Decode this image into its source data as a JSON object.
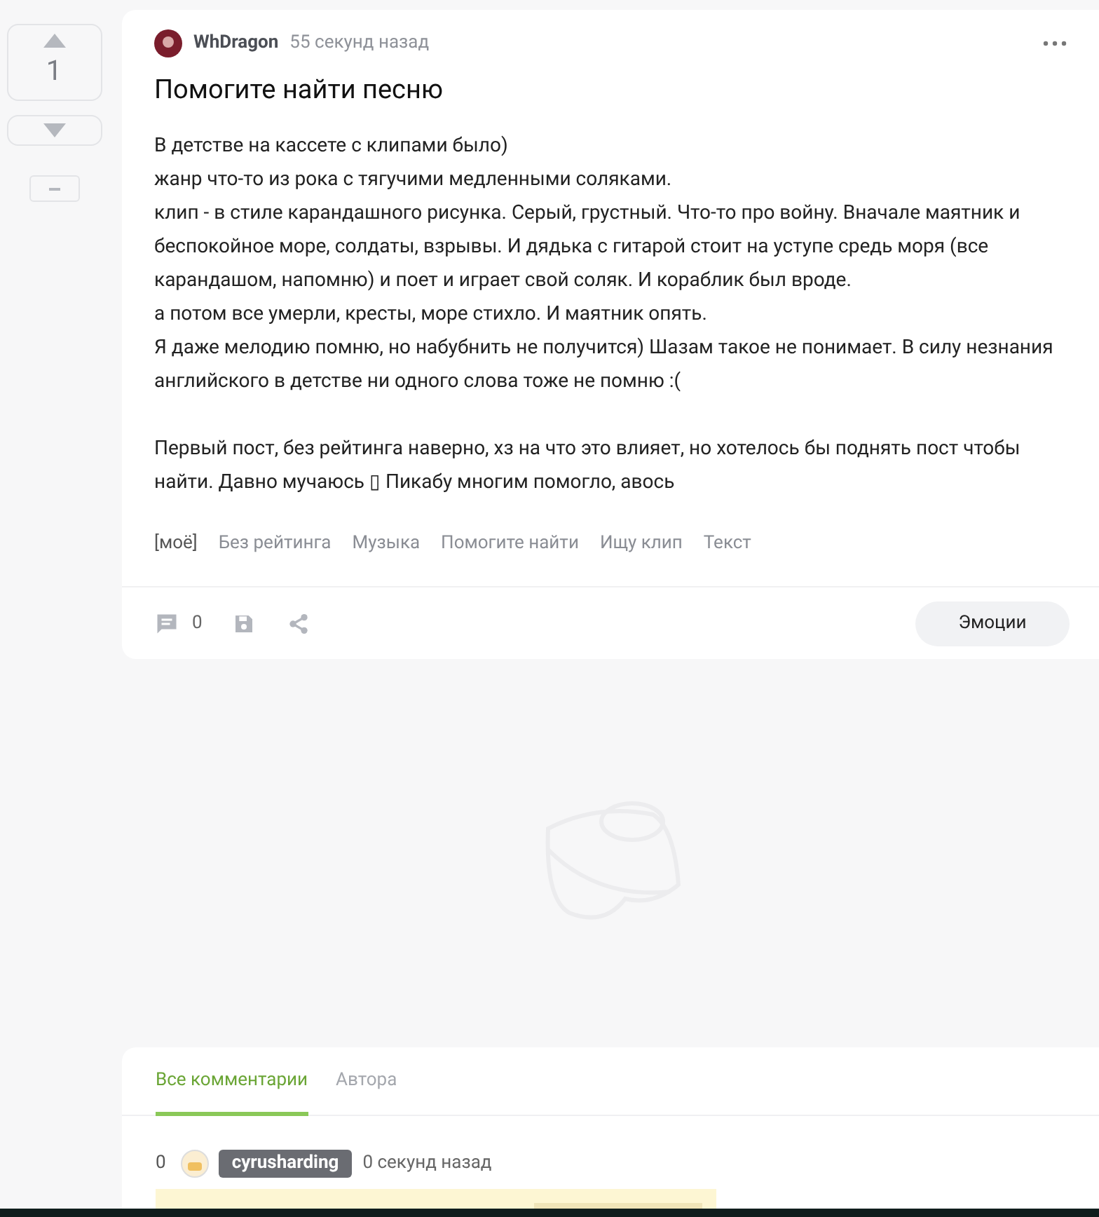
{
  "vote": {
    "score": "1"
  },
  "post": {
    "author": "WhDragon",
    "time": "55 секунд назад",
    "title": "Помогите найти песню",
    "paragraphs": [
      "В детстве на кассете с клипами было)\nжанр что-то из рока с тягучими медленными соляками.\nклип - в стиле карандашного рисунка. Серый, грустный. Что-то про войну. Вначале маятник и беспокойное море, солдаты, взрывы. И дядька с гитарой стоит на уступе средь моря (все карандашом, напомню) и поет и играет свой соляк. И кораблик был вроде.\nа потом все умерли, кресты, море стихло. И маятник опять.\nЯ даже мелодию помню, но набубнить не получится) Шазам такое не понимает. В силу незнания английского в детстве ни одного слова тоже не помню :(",
      "Первый пост, без рейтинга наверно, хз на что это влияет, но хотелось бы поднять пост чтобы найти. Давно мучаюсь ▯ Пикабу многим помогло, авось"
    ],
    "tags": [
      "[моё]",
      "Без рейтинга",
      "Музыка",
      "Помогите найти",
      "Ищу клип",
      "Текст"
    ],
    "comments_count": "0",
    "emotions_button": "Эмоции"
  },
  "comments": {
    "tabs": [
      {
        "label": "Все комментарии",
        "selected": true
      },
      {
        "label": "Автора",
        "selected": false
      }
    ],
    "items": [
      {
        "rating": "0",
        "author": "cyrusharding",
        "time": "0 секунд назад"
      }
    ]
  }
}
